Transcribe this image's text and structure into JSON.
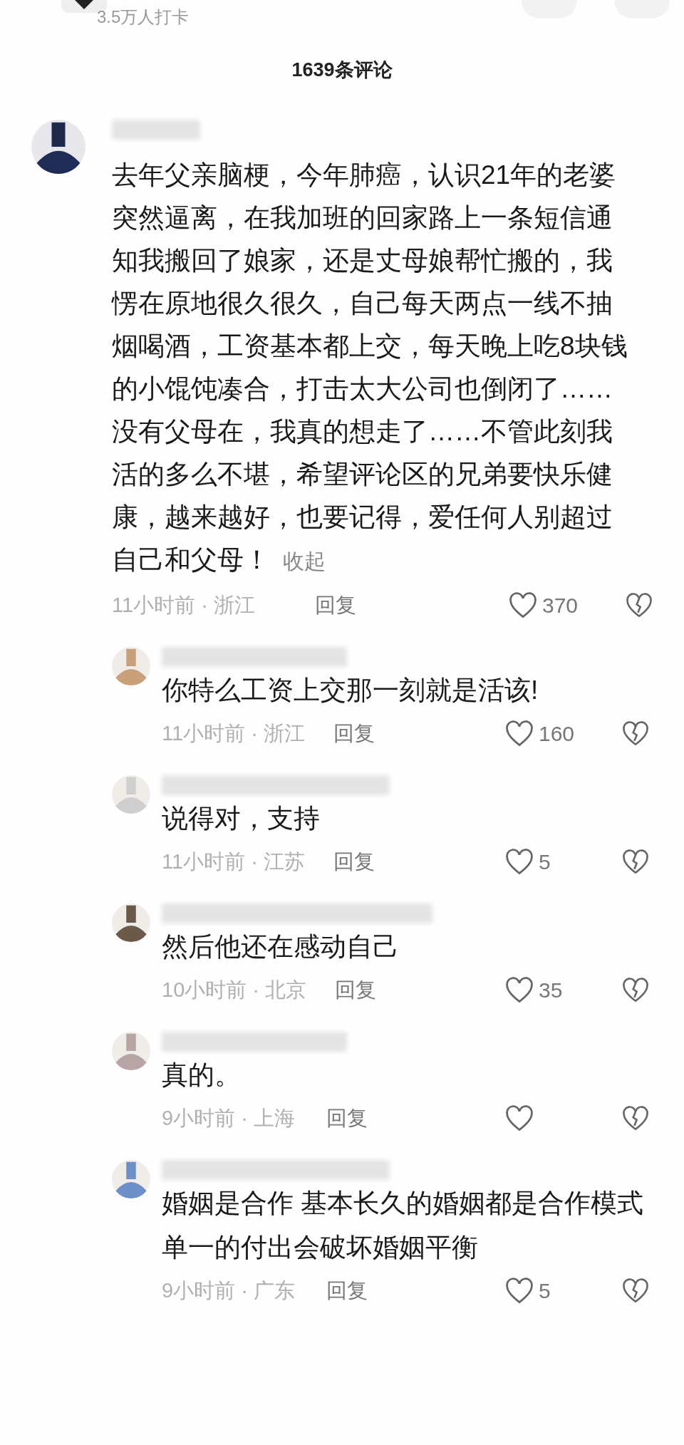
{
  "header": {
    "checkin": "3.5万人打卡"
  },
  "title": "1639条评论",
  "comments": [
    {
      "text": "去年父亲脑梗，今年肺癌，认识21年的老婆突然逼离，在我加班的回家路上一条短信通知我搬回了娘家，还是丈母娘帮忙搬的，我愣在原地很久很久，自己每天两点一线不抽烟喝酒，工资基本都上交，每天晚上吃8块钱的小馄饨凑合，打击太大公司也倒闭了……没有父母在，我真的想走了……不管此刻我活的多么不堪，希望评论区的兄弟要快乐健康，越来越好，也要记得，爱任何人别超过自己和父母！",
      "collapse": "收起",
      "meta": "11小时前 · 浙江",
      "reply": "回复",
      "likes": "370",
      "replies": [
        {
          "text": "你特么工资上交那一刻就是活该!",
          "meta": "11小时前 · 浙江",
          "reply": "回复",
          "likes": "160"
        },
        {
          "text": "说得对，支持",
          "meta": "11小时前 · 江苏",
          "reply": "回复",
          "likes": "5"
        },
        {
          "text": "然后他还在感动自己",
          "meta": "10小时前 · 北京",
          "reply": "回复",
          "likes": "35"
        },
        {
          "text": "真的。",
          "meta": "9小时前 · 上海",
          "reply": "回复"
        },
        {
          "text": "婚姻是合作 基本长久的婚姻都是合作模式",
          "more": "单一的付出会破坏婚姻平衡",
          "meta": "9小时前 · 广东",
          "reply": "回复",
          "likes": "5"
        }
      ]
    }
  ]
}
